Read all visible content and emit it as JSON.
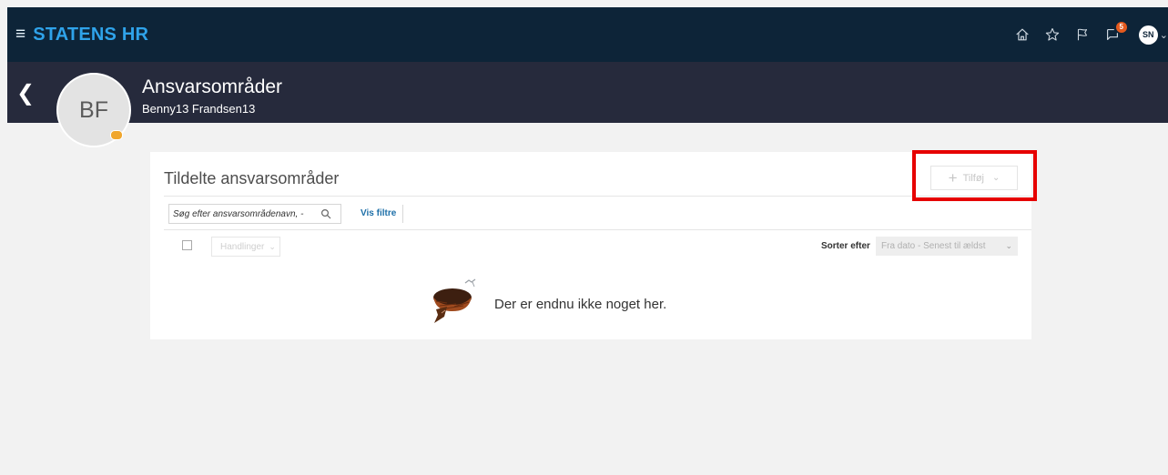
{
  "app": {
    "brand": "STATENS HR",
    "menu_glyph": "≡",
    "notification_count": "5",
    "user_initials": "SN"
  },
  "topbar_icons": [
    "home-icon",
    "star-icon",
    "flag-icon",
    "notifications-icon"
  ],
  "header": {
    "title": "Ansvarsområder",
    "subtitle": "Benny13 Frandsen13",
    "avatar_initials": "BF"
  },
  "card": {
    "title": "Tildelte ansvarsområder",
    "add_button_label": "Tilføj",
    "search_placeholder": "Søg efter ansvarsområdenavn, -",
    "filters_link": "Vis filtre",
    "actions_label": "Handlinger",
    "sort_label": "Sorter efter",
    "sort_value": "Fra dato - Senest til ældst",
    "empty_message": "Der er endnu ikke noget her."
  },
  "colors": {
    "topbar_bg": "#0d2438",
    "brand": "#2fa3ea",
    "header_bg": "#262a3c",
    "highlight": "#e60000",
    "link": "#1d6fa8",
    "badge": "#e45a1e"
  }
}
